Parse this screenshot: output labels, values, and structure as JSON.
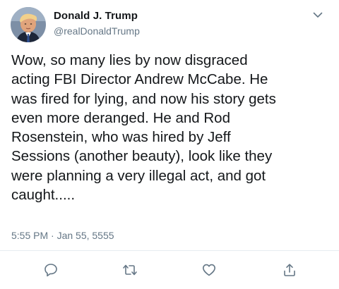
{
  "author": {
    "display_name": "Donald J. Trump",
    "handle": "@realDonaldTrump"
  },
  "tweet": {
    "text": "Wow, so many lies by now disgraced\nacting FBI Director Andrew McCabe. He\nwas fired for lying, and now his story gets\neven more deranged. He and Rod\nRosenstein, who was hired by Jeff\nSessions (another beauty), look like they\nwere planning a very illegal act, and got\ncaught.....",
    "timestamp": "5:55 PM · Jan 55, 5555"
  },
  "icons": {
    "menu": "chevron-down-icon",
    "reply": "reply-icon",
    "retweet": "retweet-icon",
    "like": "heart-icon",
    "share": "share-icon"
  },
  "colors": {
    "text": "#14171a",
    "secondary": "#657786",
    "icon": "#657786",
    "divider": "#e6ecf0"
  }
}
